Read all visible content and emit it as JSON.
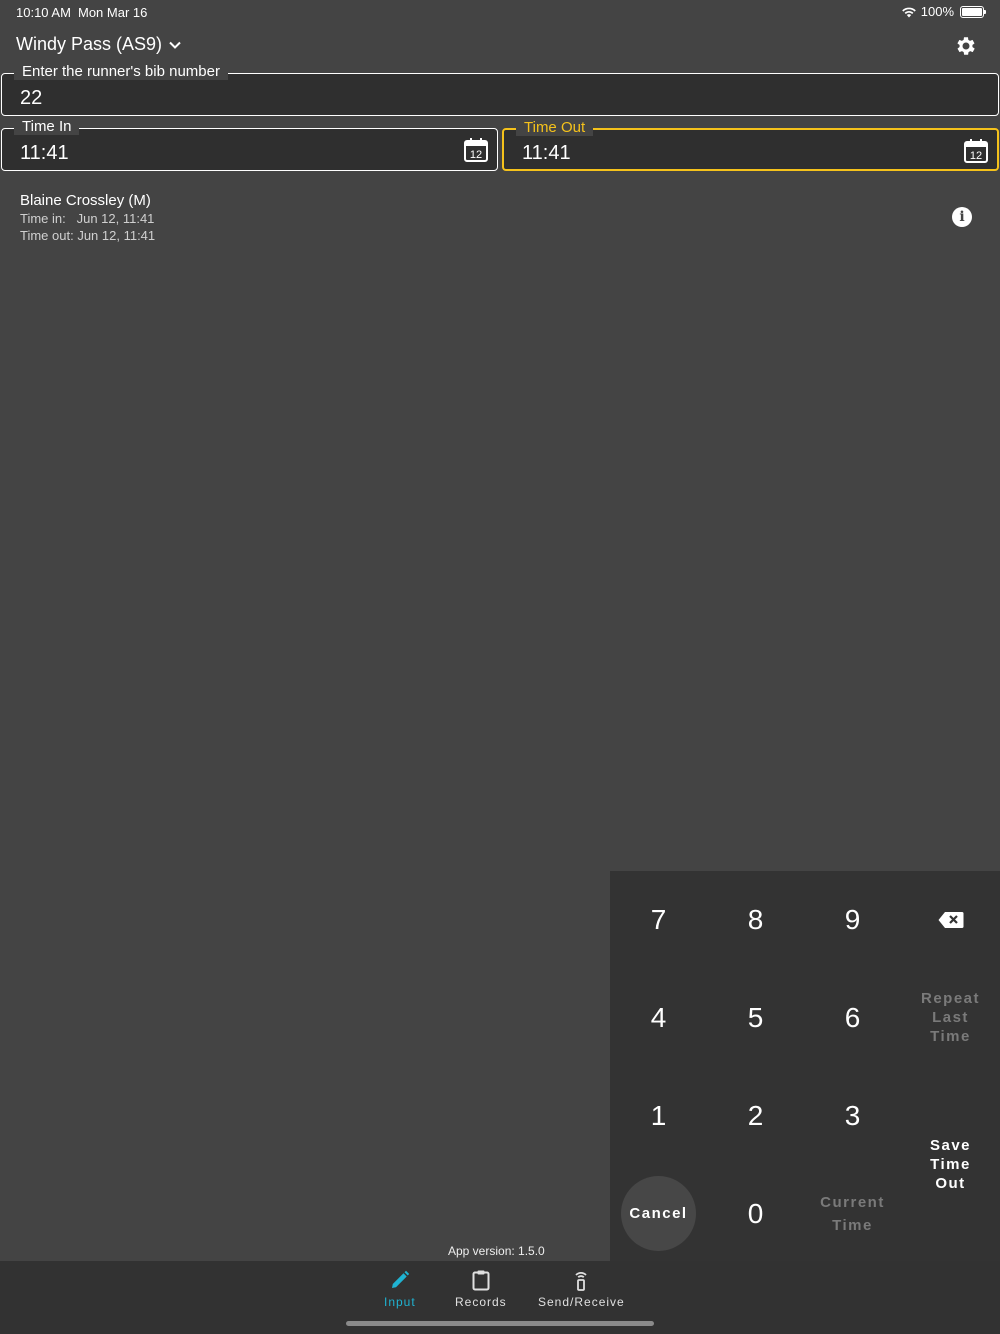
{
  "status": {
    "time": "10:10 AM",
    "date": "Mon Mar 16",
    "battery": "100%"
  },
  "header": {
    "station": "Windy Pass (AS9)"
  },
  "bib": {
    "label": "Enter the runner's bib number",
    "value": "22"
  },
  "time_in": {
    "label": "Time In",
    "value": "11:41",
    "calendar_day": "12"
  },
  "time_out": {
    "label": "Time Out",
    "value": "11:41",
    "calendar_day": "12"
  },
  "record": {
    "name": "Blaine Crossley (M)",
    "time_in": "Time in:   Jun 12, 11:41",
    "time_out": "Time out: Jun 12, 11:41"
  },
  "keypad": {
    "k7": "7",
    "k8": "8",
    "k9": "9",
    "k4": "4",
    "k5": "5",
    "k6": "6",
    "k1": "1",
    "k2": "2",
    "k3": "3",
    "k0": "0",
    "repeat": "Repeat Last Time",
    "save": "Save Time Out",
    "current": "Current Time",
    "cancel": "Cancel"
  },
  "app_version": "App version: 1.5.0",
  "tabs": [
    {
      "label": "Input",
      "icon": "pencil-icon",
      "active": true
    },
    {
      "label": "Records",
      "icon": "clipboard-icon",
      "active": false
    },
    {
      "label": "Send/Receive",
      "icon": "antenna-icon",
      "active": false
    }
  ],
  "colors": {
    "accent": "#f5c21b",
    "tab_active": "#1fb3d2",
    "background": "#444444",
    "keypad": "#333333"
  }
}
